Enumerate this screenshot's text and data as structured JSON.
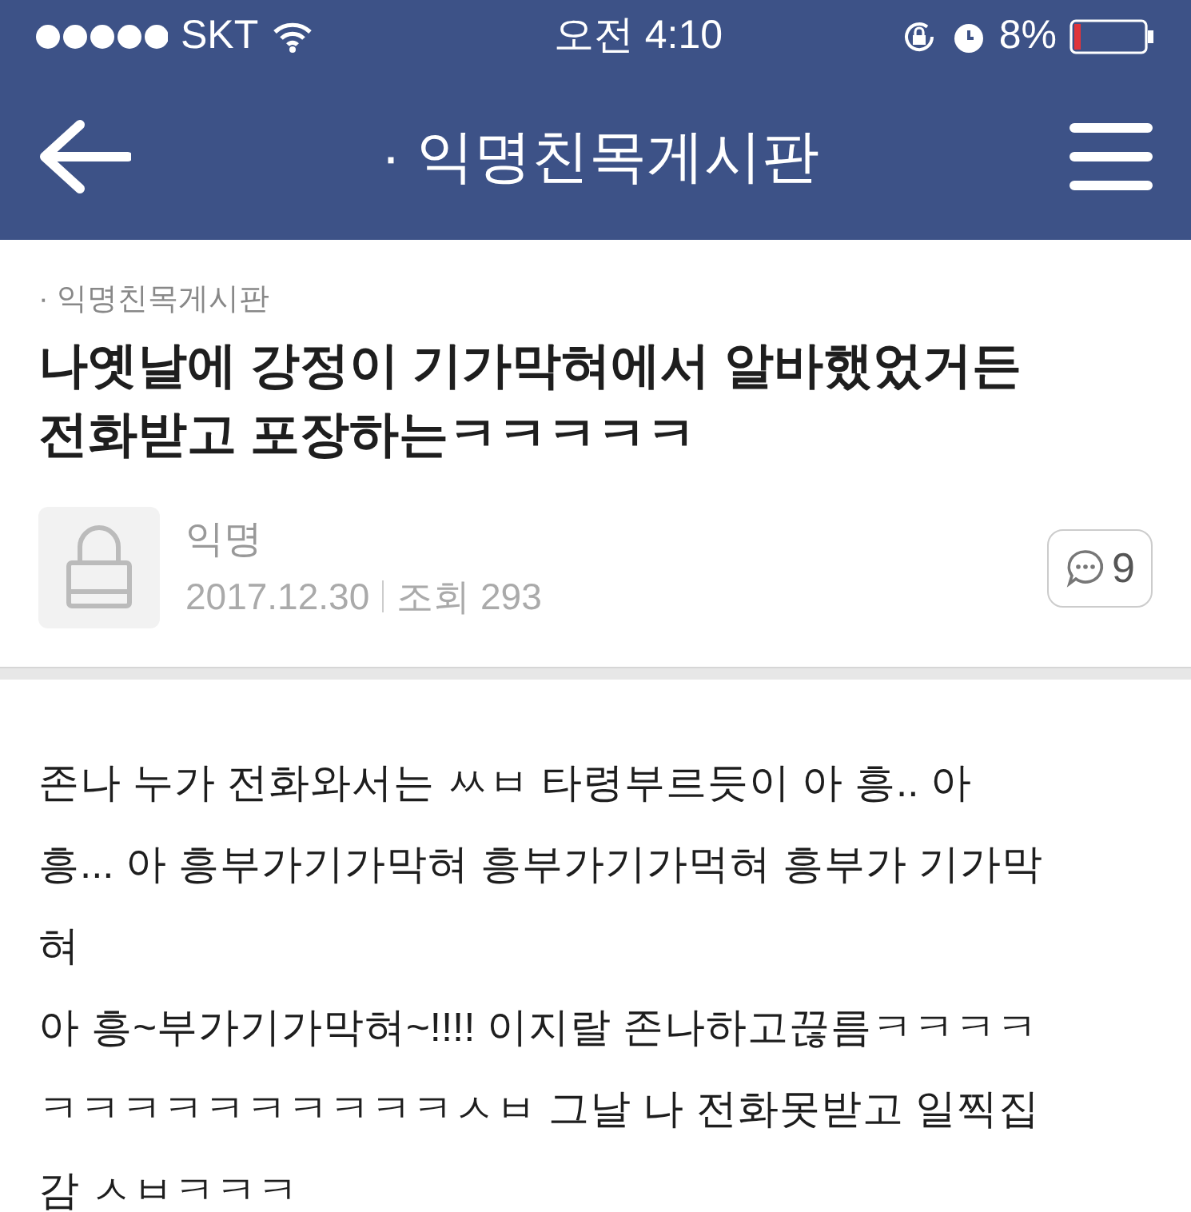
{
  "status_bar": {
    "carrier": "SKT",
    "time": "오전 4:10",
    "battery": "8%"
  },
  "navbar": {
    "title": "· 익명친목게시판"
  },
  "post": {
    "board": "· 익명친목게시판",
    "title_lines": [
      "나옛날에 강정이 기가막혀에서 알바했었거든",
      "전화받고 포장하는ㅋㅋㅋㅋㅋ"
    ],
    "author": "익명",
    "date": "2017.12.30",
    "views": "조회 293",
    "comments": "9",
    "body_lines": [
      "존나 누가 전화와서는 ㅆㅂ 타령부르듯이 아 흥.. 아",
      "흥... 아 흥부가기가막혀 흥부가기가먹혀 흥부가 기가막",
      "혀",
      "아 흥~부가기가막혀~!!!! 이지랄 존나하고끊름ㅋㅋㅋㅋ",
      "ㅋㅋㅋㅋㅋㅋㅋㅋㅋㅋㅅㅂ 그날 나 전화못받고 일찍집",
      "감 ㅅㅂㅋㅋㅋ"
    ]
  }
}
